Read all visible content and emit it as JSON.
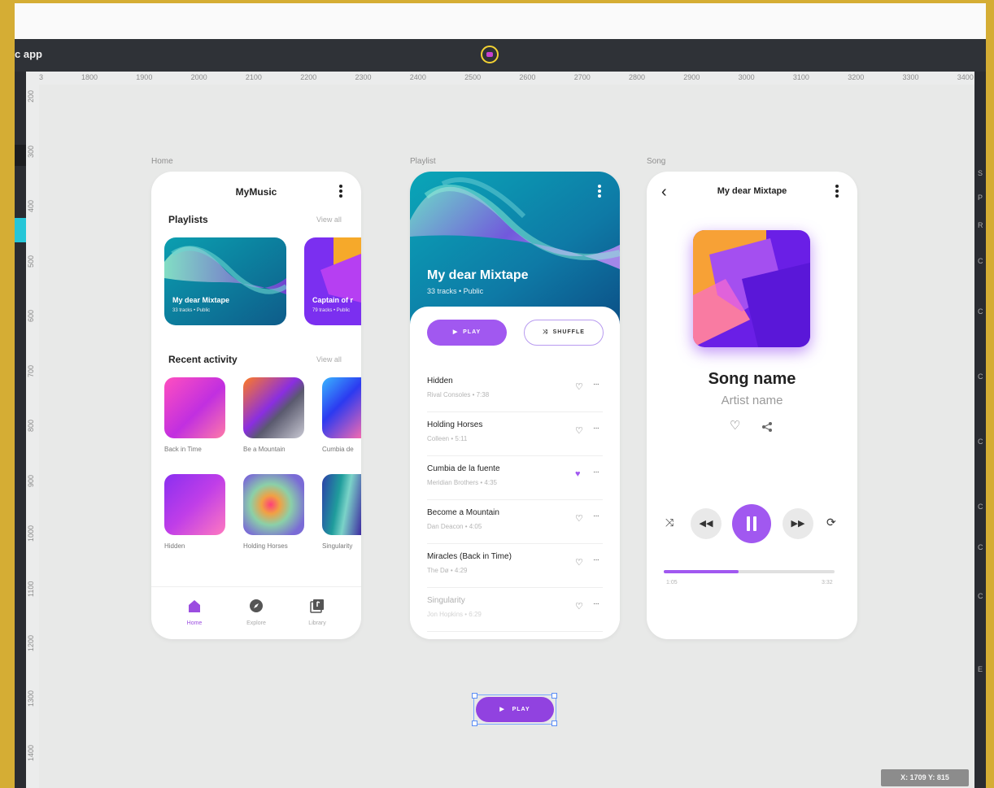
{
  "app": {
    "title": "c app"
  },
  "ruler": {
    "top_ticks": [
      "3",
      "1800",
      "1900",
      "2000",
      "2100",
      "2200",
      "2300",
      "2400",
      "2500",
      "2600",
      "2700",
      "2800",
      "2900",
      "3000",
      "3100",
      "3200",
      "3300",
      "3400"
    ],
    "left_ticks": [
      "200",
      "300",
      "400",
      "500",
      "600",
      "700",
      "800",
      "900",
      "1000",
      "1100",
      "1200",
      "1300",
      "1400"
    ]
  },
  "right_panel": {
    "letters": [
      "S",
      "P",
      "R",
      "C",
      "C",
      "C",
      "C",
      "C",
      "C",
      "C",
      "E"
    ]
  },
  "frames": {
    "home": "Home",
    "playlist": "Playlist",
    "song": "Song"
  },
  "home": {
    "app_title": "MyMusic",
    "playlists_title": "Playlists",
    "view_all_playlists": "View all",
    "playlists": [
      {
        "name": "My dear Mixtape",
        "meta": "33 tracks • Public"
      },
      {
        "name": "Captain of r",
        "meta": "79 tracks • Public"
      }
    ],
    "recent_title": "Recent activity",
    "view_all_recent": "View all",
    "recent": [
      {
        "label": "Back in Time"
      },
      {
        "label": "Be a Mountain"
      },
      {
        "label": "Cumbia de"
      },
      {
        "label": "Hidden"
      },
      {
        "label": "Holding Horses"
      },
      {
        "label": "Singularity"
      }
    ],
    "nav": [
      {
        "label": "Home",
        "icon": "home-icon"
      },
      {
        "label": "Explore",
        "icon": "compass-icon"
      },
      {
        "label": "Library",
        "icon": "library-icon"
      }
    ]
  },
  "playlist": {
    "title": "My dear Mixtape",
    "meta": "33 tracks • Public",
    "play_label": "PLAY",
    "shuffle_label": "SHUFFLE",
    "tracks": [
      {
        "name": "Hidden",
        "artist": "Rival Consoles",
        "duration": "7:38",
        "fav": false
      },
      {
        "name": "Holding Horses",
        "artist": "Colleen",
        "duration": "5:11",
        "fav": false
      },
      {
        "name": "Cumbia de la fuente",
        "artist": "Meridian Brothers",
        "duration": "4:35",
        "fav": true
      },
      {
        "name": "Become a Mountain",
        "artist": "Dan Deacon",
        "duration": "4:05",
        "fav": false
      },
      {
        "name": "Miracles (Back in Time)",
        "artist": "The Dø",
        "duration": "4:29",
        "fav": false
      },
      {
        "name": "Singularity",
        "artist": "Jon Hopkins",
        "duration": "6:29",
        "fav": false
      }
    ]
  },
  "song": {
    "title": "My dear Mixtape",
    "name": "Song name",
    "artist": "Artist name",
    "progress": 0.44,
    "time_elapsed": "1:05",
    "time_total": "3:32"
  },
  "floating_button": {
    "label": "PLAY"
  },
  "coords_readout": "X: 1709  Y: 815",
  "colors": {
    "accent": "#a158f0",
    "titlebar": "#2f3237",
    "canvas": "#e8e9e8"
  }
}
